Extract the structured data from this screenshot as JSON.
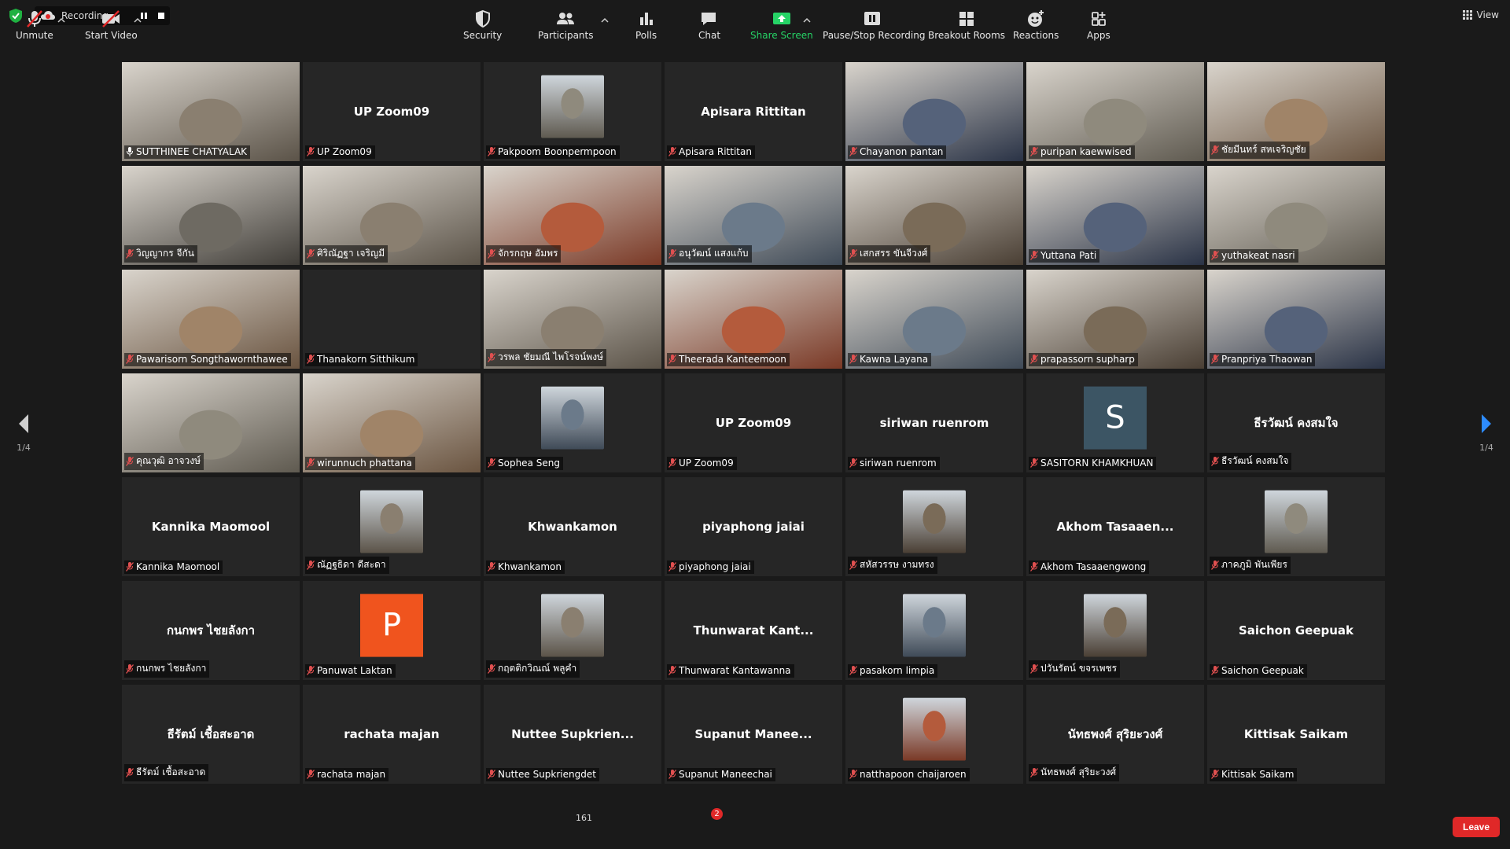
{
  "recording": {
    "text": "Recording..."
  },
  "view": {
    "label": "View"
  },
  "pager": {
    "left": "1/4",
    "right": "1/4"
  },
  "toolbar": {
    "unmute": "Unmute",
    "start_video": "Start Video",
    "security": "Security",
    "participants": "Participants",
    "participants_count": "161",
    "polls": "Polls",
    "chat": "Chat",
    "chat_badge": "2",
    "share_screen": "Share Screen",
    "pause_stop_recording": "Pause/Stop Recording",
    "breakout_rooms": "Breakout Rooms",
    "reactions": "Reactions",
    "apps": "Apps",
    "leave": "Leave"
  },
  "colors": {
    "active_border": "#e6e46a",
    "leave": "#e02828",
    "share_green": "#26d366",
    "muted_red": "#e05050"
  },
  "participants": [
    {
      "name": "SUTTHINEE CHATYALAK",
      "type": "video",
      "active": true
    },
    {
      "name": "UP Zoom09",
      "display": "UP Zoom09",
      "type": "text"
    },
    {
      "name": "Pakpoom Boonpermpoon",
      "type": "thumb"
    },
    {
      "name": "Apisara Rittitan",
      "display": "Apisara Rittitan",
      "type": "text"
    },
    {
      "name": "Chayanon pantan",
      "type": "video"
    },
    {
      "name": "puripan kaewwised",
      "type": "video"
    },
    {
      "name": "ชัยมีนทร์ สหเจริญชัย",
      "type": "video"
    },
    {
      "name": "วิญญากร จีกัน",
      "type": "video"
    },
    {
      "name": "ศิริณัฏฐา เจริญมี",
      "type": "video"
    },
    {
      "name": "จักรกฤษ อัมพร",
      "type": "video"
    },
    {
      "name": "อนุวัฒน์ แสงแก้บ",
      "type": "video"
    },
    {
      "name": "เสกสรร ขันจีวงศ์",
      "type": "video"
    },
    {
      "name": "Yuttana Pati",
      "type": "video"
    },
    {
      "name": "yuthakeat nasri",
      "type": "video"
    },
    {
      "name": "Pawarisorn Songthawornthawee",
      "type": "video"
    },
    {
      "name": "Thanakorn Sitthikum",
      "type": "blank"
    },
    {
      "name": "วรพล ชัยมณี ไพโรจน์พงษ์",
      "type": "video"
    },
    {
      "name": "Theerada Kanteemoon",
      "type": "video"
    },
    {
      "name": "Kawna Layana",
      "type": "video"
    },
    {
      "name": "prapassorn supharp",
      "type": "video"
    },
    {
      "name": "Pranpriya Thaowan",
      "type": "video"
    },
    {
      "name": "คุณวุฒิ อาจวงษ์",
      "type": "video"
    },
    {
      "name": "wirunnuch phattana",
      "type": "video"
    },
    {
      "name": "Sophea Seng",
      "type": "thumb"
    },
    {
      "name": "UP Zoom09",
      "display": "UP Zoom09",
      "type": "text"
    },
    {
      "name": "siriwan ruenrom",
      "display": "siriwan ruenrom",
      "type": "text"
    },
    {
      "name": "SASITORN KHAMKHUAN",
      "type": "letter",
      "letter": "S",
      "color": "#3c5564"
    },
    {
      "name": "ธีรวัฒน์ คงสมใจ",
      "display": "ธีรวัฒน์ คงสมใจ",
      "type": "text"
    },
    {
      "name": "Kannika Maomool",
      "display": "Kannika Maomool",
      "type": "text"
    },
    {
      "name": "ณัฏฐธิดา ดีสะดา",
      "type": "thumb"
    },
    {
      "name": "Khwankamon",
      "display": "Khwankamon",
      "type": "text"
    },
    {
      "name": "piyaphong jaiai",
      "display": "piyaphong jaiai",
      "type": "text"
    },
    {
      "name": "สหัสวรรษ งามทรง",
      "type": "thumb"
    },
    {
      "name": "Akhom Tasaaengwong",
      "display": "Akhom  Tasaaen...",
      "type": "text"
    },
    {
      "name": "ภาคภูมิ พันเพียร",
      "type": "thumb"
    },
    {
      "name": "กนกพร ไชยลังกา",
      "display": "กนกพร ไชยลังกา",
      "type": "text"
    },
    {
      "name": "Panuwat Laktan",
      "type": "letter",
      "letter": "P",
      "color": "#f0541e"
    },
    {
      "name": "กฤตติกวิณณ์ พลูคำ",
      "type": "thumb"
    },
    {
      "name": "Thunwarat Kantawanna",
      "display": "Thunwarat  Kant...",
      "type": "text"
    },
    {
      "name": "pasakorn limpia",
      "type": "thumb"
    },
    {
      "name": "ปวันรัตน์ ขจรเพชร",
      "type": "thumb"
    },
    {
      "name": "Saichon Geepuak",
      "display": "Saichon Geepuak",
      "type": "text"
    },
    {
      "name": "ธีรัตม์ เชื้อสะอาด",
      "display": "ธีรัตม์ เชื้อสะอาด",
      "type": "text"
    },
    {
      "name": "rachata majan",
      "display": "rachata majan",
      "type": "text"
    },
    {
      "name": "Nuttee Supkriengdet",
      "display": "Nuttee  Supkrien...",
      "type": "text"
    },
    {
      "name": "Supanut Maneechai",
      "display": "Supanut  Manee...",
      "type": "text"
    },
    {
      "name": "natthapoon chaijaroen",
      "type": "thumb"
    },
    {
      "name": "นัทธพงศ์ สุริยะวงศ์",
      "display": "นัทธพงศ์ สุริยะวงศ์",
      "type": "text"
    },
    {
      "name": "Kittisak Saikam",
      "display": "Kittisak Saikam",
      "type": "text"
    }
  ]
}
